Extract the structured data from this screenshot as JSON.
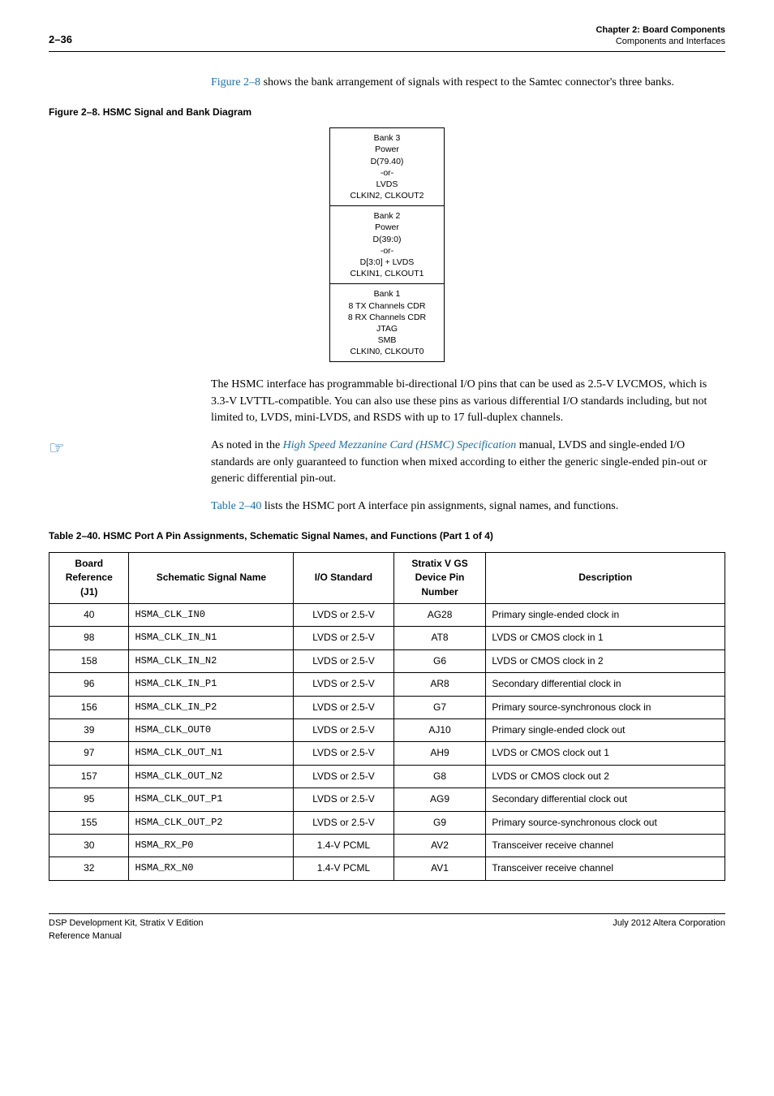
{
  "header": {
    "page_number": "2–36",
    "chapter_title": "Chapter 2: Board Components",
    "chapter_sub": "Components and Interfaces"
  },
  "intro": {
    "xref": "Figure 2–8",
    "rest": " shows the bank arrangement of signals with respect to the Samtec connector's three banks."
  },
  "figure": {
    "caption": "Figure 2–8.  HSMC Signal and Bank Diagram",
    "bank3": [
      "Bank 3",
      "Power",
      "D(79.40)",
      "-or-",
      "LVDS",
      "CLKIN2, CLKOUT2"
    ],
    "bank2": [
      "Bank 2",
      "Power",
      "D(39:0)",
      "-or-",
      "D[3:0] + LVDS",
      "CLKIN1, CLKOUT1"
    ],
    "bank1": [
      "Bank 1",
      "8 TX Channels CDR",
      "8 RX Channels CDR",
      "JTAG",
      "SMB",
      "CLKIN0, CLKOUT0"
    ]
  },
  "para2": "The HSMC interface has programmable bi-directional I/O pins that can be used as 2.5-V LVCMOS, which is 3.3-V LVTTL-compatible. You can also use these pins as various differential I/O standards including, but not limited to, LVDS, mini-LVDS, and RSDS with up to 17 full-duplex channels.",
  "note": {
    "pre": "As noted in the ",
    "link": "High Speed Mezzanine Card (HSMC) Specification",
    "post": " manual, LVDS and single-ended I/O standards are only guaranteed to function when mixed according to either the generic single-ended pin-out or generic differential pin-out."
  },
  "para3": {
    "xref": "Table 2–40",
    "rest": " lists the HSMC port A interface pin assignments, signal names, and functions."
  },
  "table": {
    "caption": "Table 2–40.  HSMC Port A Pin Assignments, Schematic Signal Names, and Functions  (Part 1 of 4)",
    "headers": {
      "c0a": "Board",
      "c0b": "Reference",
      "c0c": "(J1)",
      "c1": "Schematic Signal Name",
      "c2": "I/O Standard",
      "c3a": "Stratix V GS",
      "c3b": "Device Pin",
      "c3c": "Number",
      "c4": "Description"
    },
    "rows": [
      {
        "ref": "40",
        "sig": "HSMA_CLK_IN0",
        "io": "LVDS or 2.5-V",
        "pin": "AG28",
        "desc": "Primary single-ended clock in"
      },
      {
        "ref": "98",
        "sig": "HSMA_CLK_IN_N1",
        "io": "LVDS or 2.5-V",
        "pin": "AT8",
        "desc": "LVDS or CMOS clock in 1"
      },
      {
        "ref": "158",
        "sig": "HSMA_CLK_IN_N2",
        "io": "LVDS or 2.5-V",
        "pin": "G6",
        "desc": "LVDS or CMOS clock in 2"
      },
      {
        "ref": "96",
        "sig": "HSMA_CLK_IN_P1",
        "io": "LVDS or 2.5-V",
        "pin": "AR8",
        "desc": "Secondary differential clock in"
      },
      {
        "ref": "156",
        "sig": "HSMA_CLK_IN_P2",
        "io": "LVDS or 2.5-V",
        "pin": "G7",
        "desc": "Primary source-synchronous clock in"
      },
      {
        "ref": "39",
        "sig": "HSMA_CLK_OUT0",
        "io": "LVDS or 2.5-V",
        "pin": "AJ10",
        "desc": "Primary single-ended clock out"
      },
      {
        "ref": "97",
        "sig": "HSMA_CLK_OUT_N1",
        "io": "LVDS or 2.5-V",
        "pin": "AH9",
        "desc": "LVDS or CMOS clock out 1"
      },
      {
        "ref": "157",
        "sig": "HSMA_CLK_OUT_N2",
        "io": "LVDS or 2.5-V",
        "pin": "G8",
        "desc": "LVDS or CMOS clock out 2"
      },
      {
        "ref": "95",
        "sig": "HSMA_CLK_OUT_P1",
        "io": "LVDS or 2.5-V",
        "pin": "AG9",
        "desc": "Secondary differential clock out"
      },
      {
        "ref": "155",
        "sig": "HSMA_CLK_OUT_P2",
        "io": "LVDS or 2.5-V",
        "pin": "G9",
        "desc": "Primary source-synchronous clock out"
      },
      {
        "ref": "30",
        "sig": "HSMA_RX_P0",
        "io": "1.4-V PCML",
        "pin": "AV2",
        "desc": "Transceiver receive channel"
      },
      {
        "ref": "32",
        "sig": "HSMA_RX_N0",
        "io": "1.4-V PCML",
        "pin": "AV1",
        "desc": "Transceiver receive channel"
      }
    ]
  },
  "footer": {
    "left1": "DSP Development Kit, Stratix V Edition",
    "left2": "Reference Manual",
    "right": "July 2012  Altera Corporation"
  }
}
